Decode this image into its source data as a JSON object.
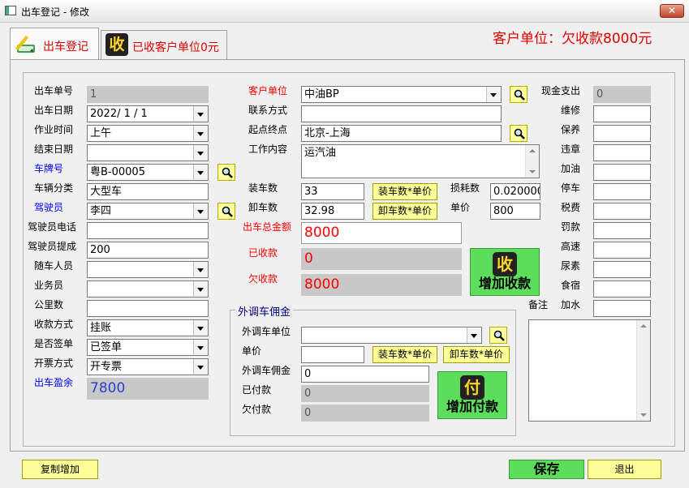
{
  "window": {
    "title": "出车登记 - 修改",
    "close_glyph": "✕"
  },
  "tabs": [
    {
      "label": "出车登记"
    },
    {
      "label": "已收客户单位0元",
      "icon_char": "收"
    }
  ],
  "banner": "客户单位：欠收款8000元",
  "left": {
    "order_no": {
      "label": "出车单号",
      "value": "1"
    },
    "date": {
      "label": "出车日期",
      "value": "2022/ 1 / 1"
    },
    "work_time": {
      "label": "作业时间",
      "value": "上午"
    },
    "end_date": {
      "label": "结束日期",
      "value": ""
    },
    "plate": {
      "label": "车牌号",
      "value": "粤B-00005"
    },
    "vehicle_type": {
      "label": "车辆分类",
      "value": "大型车"
    },
    "driver": {
      "label": "驾驶员",
      "value": "李四"
    },
    "driver_phone": {
      "label": "驾驶员电话",
      "value": ""
    },
    "driver_commission": {
      "label": "驾驶员提成",
      "value": "200"
    },
    "companion": {
      "label": "随车人员",
      "value": ""
    },
    "salesman": {
      "label": "业务员",
      "value": ""
    },
    "mileage": {
      "label": "公里数",
      "value": ""
    },
    "payment_method": {
      "label": "收款方式",
      "value": "挂账"
    },
    "signed": {
      "label": "是否签单",
      "value": "已签单"
    },
    "invoice": {
      "label": "开票方式",
      "value": "开专票"
    },
    "profit": {
      "label": "出车盈余",
      "value": "7800"
    }
  },
  "middle": {
    "customer": {
      "label": "客户单位",
      "value": "中油BP"
    },
    "contact": {
      "label": "联系方式",
      "value": ""
    },
    "route": {
      "label": "起点终点",
      "value": "北京-上海"
    },
    "work_content": {
      "label": "工作内容",
      "value": "运汽油"
    },
    "load_count": {
      "label": "装车数",
      "value": "33"
    },
    "unload_count": {
      "label": "卸车数",
      "value": "32.98"
    },
    "load_price_btn": "装车数*单价",
    "unload_price_btn": "卸车数*单价",
    "loss": {
      "label": "损耗数",
      "value": "0.020000"
    },
    "unit_price": {
      "label": "单价",
      "value": "800"
    },
    "total": {
      "label": "出车总金额",
      "value": "8000"
    },
    "received": {
      "label": "已收款",
      "value": "0"
    },
    "owed": {
      "label": "欠收款",
      "value": "8000"
    },
    "add_receipt_btn": "增加收款",
    "add_receipt_icon": "收"
  },
  "outsourced": {
    "title": "外调车佣金",
    "unit": {
      "label": "外调车单位",
      "value": ""
    },
    "price": {
      "label": "单价",
      "value": ""
    },
    "load_price_btn": "装车数*单价",
    "unload_price_btn": "卸车数*单价",
    "commission": {
      "label": "外调车佣金",
      "value": "0"
    },
    "paid": {
      "label": "已付款",
      "value": "0"
    },
    "owed": {
      "label": "欠付款",
      "value": "0"
    },
    "add_payment_btn": "增加付款",
    "add_payment_icon": "付"
  },
  "expenses": {
    "cash": {
      "label": "现金支出",
      "value": "0"
    },
    "items": [
      {
        "label": "维修",
        "value": ""
      },
      {
        "label": "保养",
        "value": ""
      },
      {
        "label": "违章",
        "value": ""
      },
      {
        "label": "加油",
        "value": ""
      },
      {
        "label": "停车",
        "value": ""
      },
      {
        "label": "税费",
        "value": ""
      },
      {
        "label": "罚款",
        "value": ""
      },
      {
        "label": "高速",
        "value": ""
      },
      {
        "label": "尿素",
        "value": ""
      },
      {
        "label": "食宿",
        "value": ""
      },
      {
        "label": "加水",
        "value": ""
      }
    ],
    "remark_label": "备注"
  },
  "footer": {
    "copy_add": "复制增加",
    "save": "保存",
    "exit": "退出"
  }
}
